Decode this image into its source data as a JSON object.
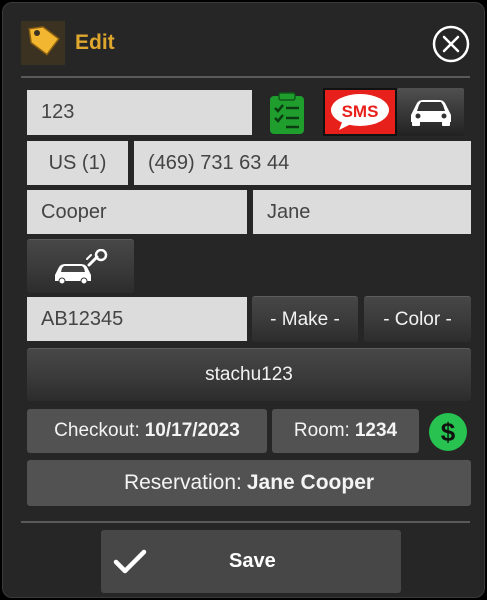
{
  "header": {
    "title": "Edit"
  },
  "form": {
    "ticket_number": "123",
    "country_code": "US (1)",
    "phone": "(469) 731 63 44",
    "last_name": "Cooper",
    "first_name": "Jane",
    "plate": "AB12345",
    "make_label": "- Make -",
    "color_label": "- Color -",
    "username": "stachu123",
    "checkout_label": "Checkout:",
    "checkout_value": "10/17/2023",
    "room_label": "Room:",
    "room_value": "1234",
    "reservation_label": "Reservation:",
    "reservation_value": "Jane Cooper"
  },
  "buttons": {
    "sms_text": "SMS",
    "save_label": "Save"
  },
  "icons": {
    "app": "tag-icon",
    "close": "close-circle-icon",
    "checklist": "checklist-icon",
    "sms": "sms-bubble-icon",
    "car": "car-icon",
    "valet": "car-key-icon",
    "payment": "dollar-icon",
    "save": "checkmark-icon"
  },
  "colors": {
    "accent": "#e0a72e",
    "sms_red": "#e8201c",
    "checklist_green": "#1f9e2e",
    "dollar_green": "#27c250",
    "background": "#262626",
    "field": "#dcdcdc"
  }
}
